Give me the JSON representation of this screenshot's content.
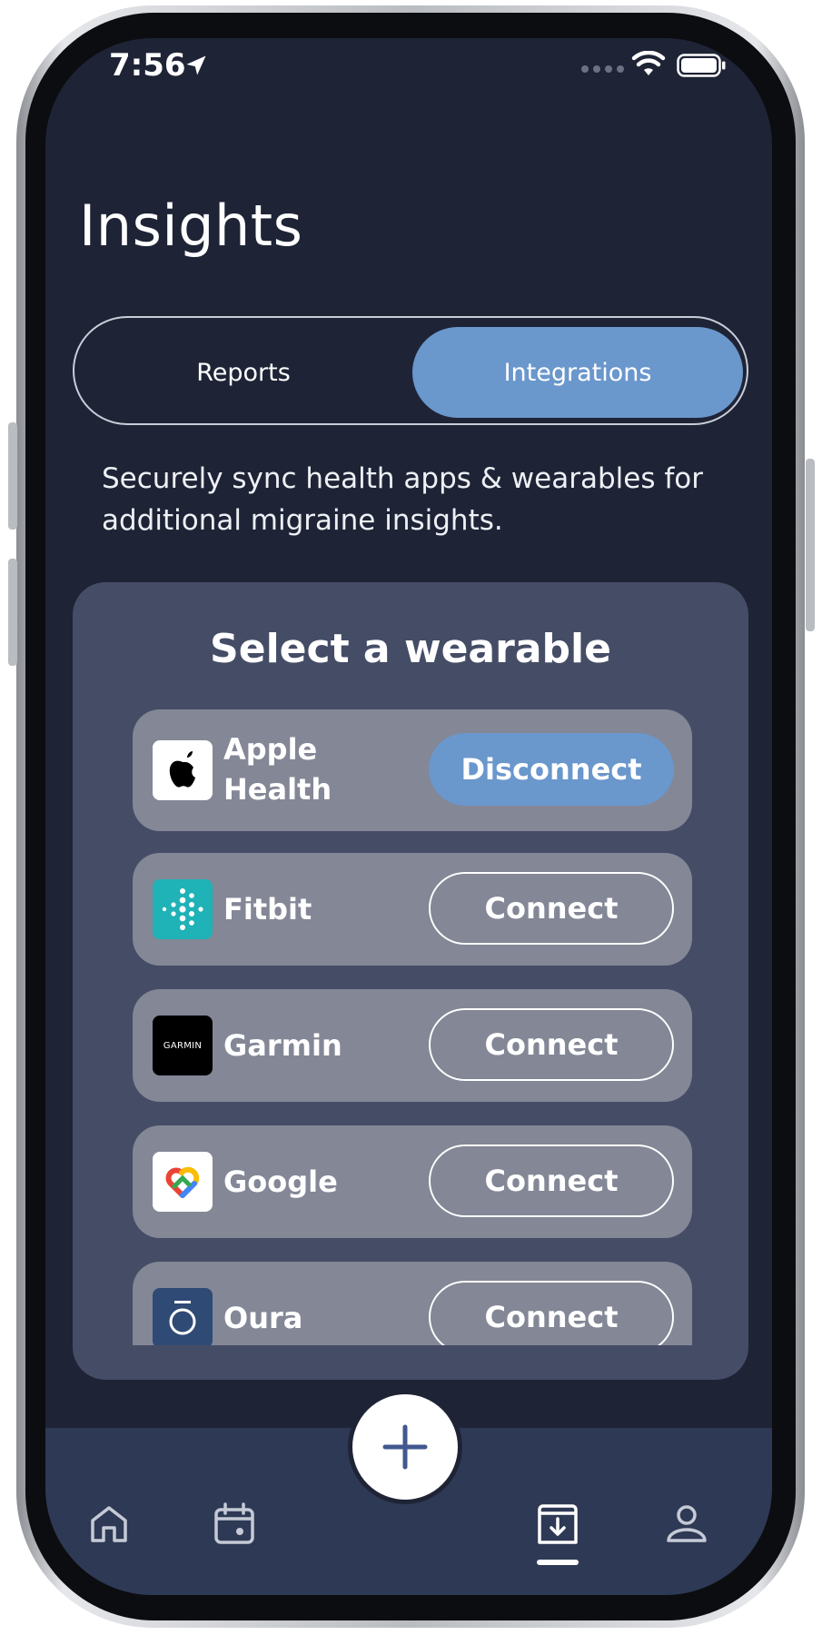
{
  "status_bar": {
    "time": "7:56",
    "icons": [
      "location-arrow-icon",
      "cellular-signal-icon",
      "wifi-icon",
      "battery-icon"
    ]
  },
  "header": {
    "title": "Insights"
  },
  "segmented_control": {
    "tabs": [
      {
        "label": "Reports",
        "selected": false
      },
      {
        "label": "Integrations",
        "selected": true
      }
    ]
  },
  "description": "Securely sync health apps & wearables for additional migraine insights.",
  "wearables": {
    "title": "Select a wearable",
    "items": [
      {
        "name": "Apple Health",
        "action": "Disconnect",
        "connected": true,
        "icon": "apple-icon"
      },
      {
        "name": "Fitbit",
        "action": "Connect",
        "connected": false,
        "icon": "fitbit-icon"
      },
      {
        "name": "Garmin",
        "action": "Connect",
        "connected": false,
        "icon": "garmin-icon",
        "icon_text": "GARMIN"
      },
      {
        "name": "Google",
        "action": "Connect",
        "connected": false,
        "icon": "google-fit-icon"
      },
      {
        "name": "Oura",
        "action": "Connect",
        "connected": false,
        "icon": "oura-icon"
      }
    ]
  },
  "tab_bar": {
    "items": [
      {
        "name": "home",
        "icon": "home-icon",
        "active": false
      },
      {
        "name": "calendar",
        "icon": "calendar-icon",
        "active": false
      },
      {
        "name": "add",
        "icon": "plus-icon",
        "active": false
      },
      {
        "name": "insights",
        "icon": "inbox-download-icon",
        "active": true
      },
      {
        "name": "profile",
        "icon": "user-icon",
        "active": false
      }
    ]
  },
  "colors": {
    "background": "#1e2436",
    "accent": "#6a97cc",
    "card": "#454d66",
    "row": "#838796",
    "tab_bar": "#2e3955"
  }
}
